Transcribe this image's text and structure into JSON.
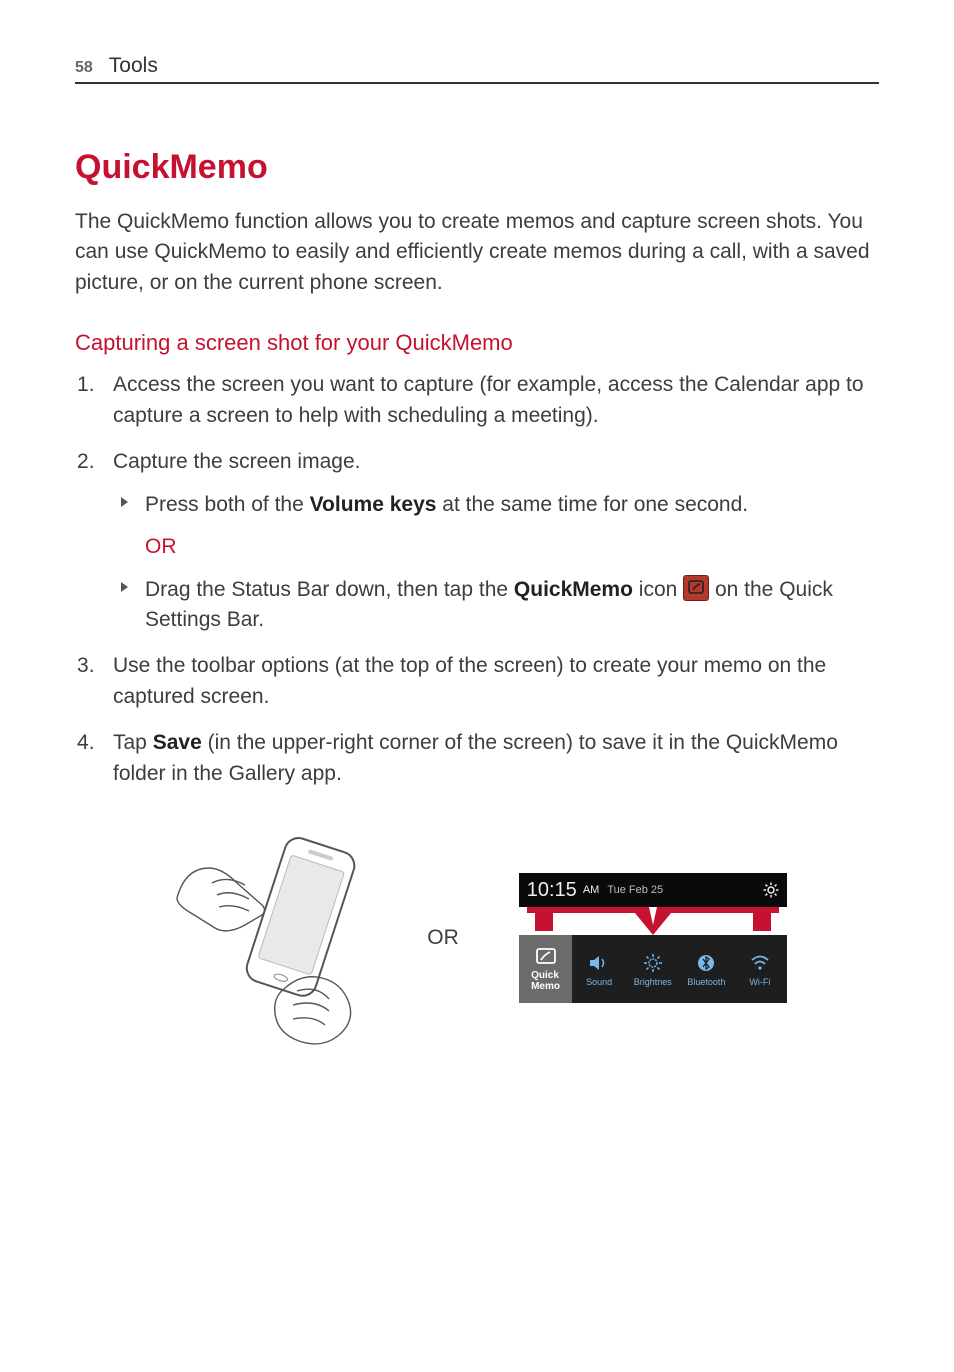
{
  "header": {
    "page_number": "58",
    "section": "Tools"
  },
  "title": "QuickMemo",
  "intro": "The QuickMemo function allows you to create memos and capture screen shots. You can use QuickMemo to easily and efficiently create memos during a call, with a saved picture, or on the current phone screen.",
  "subhead": "Capturing a screen shot for your QuickMemo",
  "step1": "Access the screen you want to capture (for example, access the Calendar app to capture a screen to help with scheduling a meeting).",
  "step2": "Capture the screen image.",
  "step2a_pre": "Press both of the ",
  "step2a_bold": "Volume keys",
  "step2a_post": " at the same time for one second.",
  "or_label": "OR",
  "step2b_pre": "Drag the Status Bar down, then tap the ",
  "step2b_bold": "QuickMemo",
  "step2b_mid": " icon ",
  "step2b_post": " on the Quick Settings Bar.",
  "step3": "Use the toolbar options (at the top of the screen) to create your memo on the captured screen.",
  "step4_pre": "Tap ",
  "step4_bold": "Save",
  "step4_post": " (in the upper-right corner of the screen) to save it in the QuickMemo folder in the Gallery app.",
  "figure_or": "OR",
  "screenshot": {
    "time": "10:15",
    "ampm": "AM",
    "date": "Tue Feb 25",
    "qs": {
      "quickmemo": "Quick Memo",
      "sound": "Sound",
      "brightness": "Brightnes",
      "bluetooth": "Bluetooth",
      "wifi": "Wi-Fi"
    }
  }
}
